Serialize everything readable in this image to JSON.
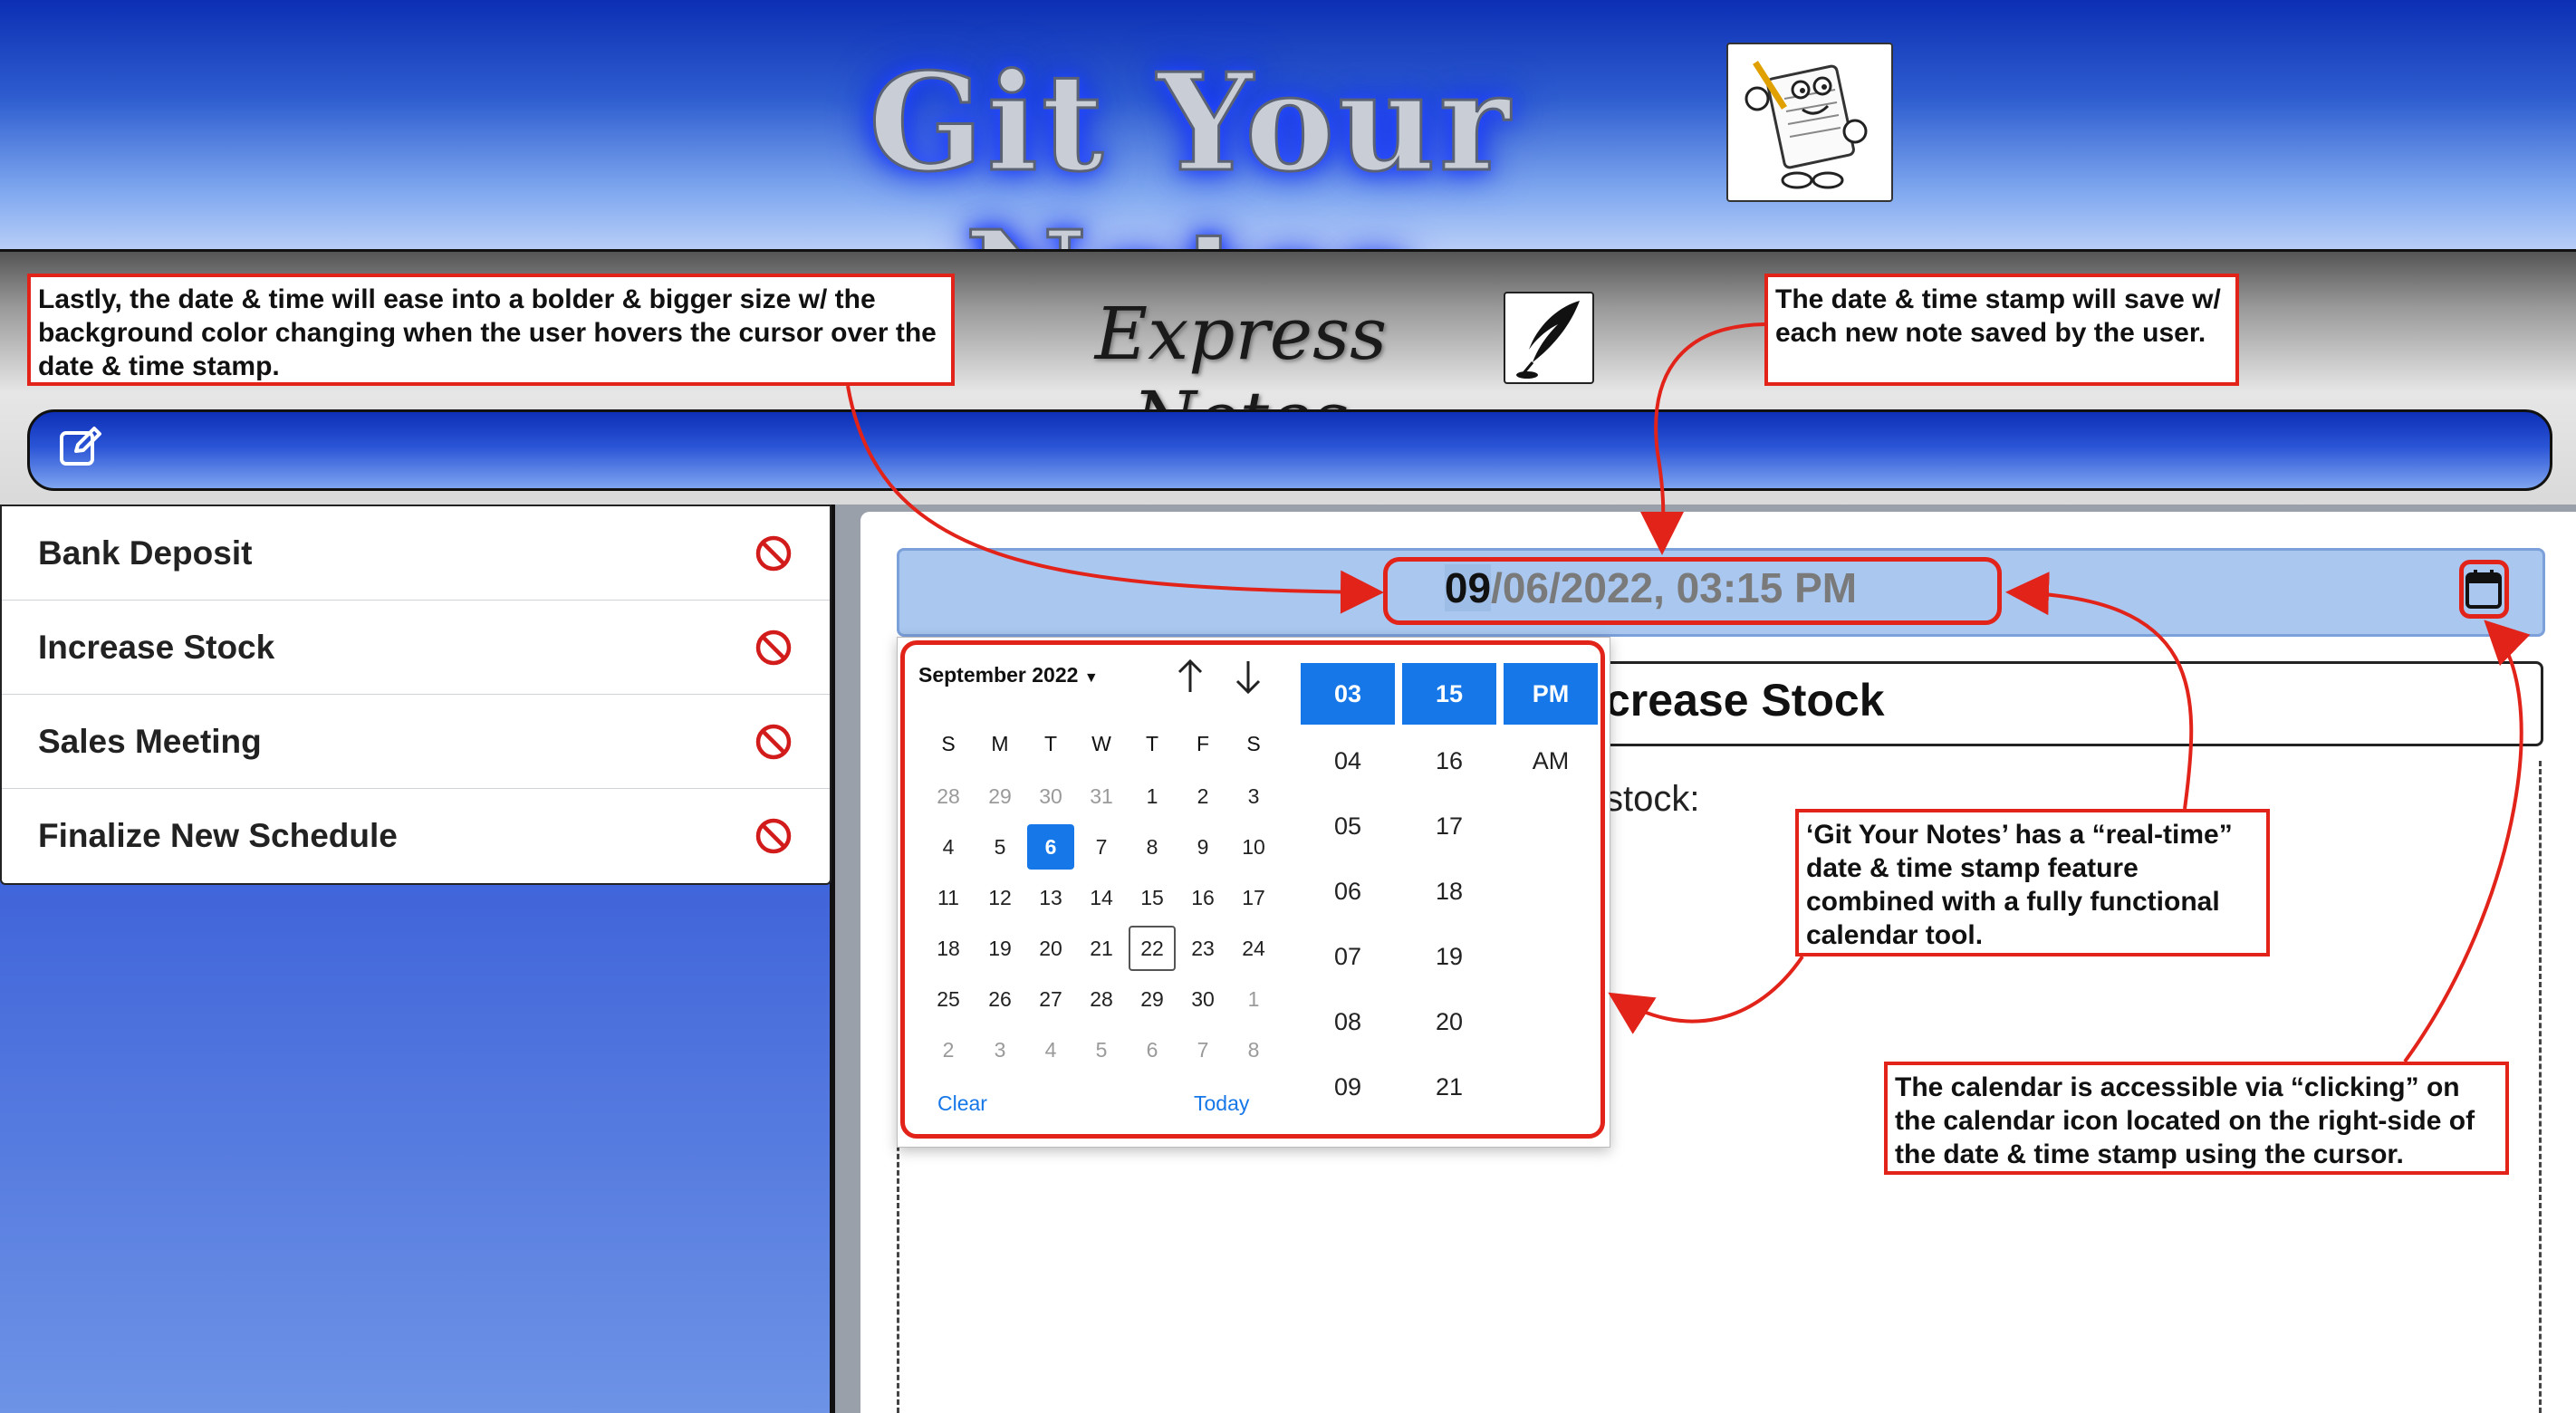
{
  "app": {
    "title": "Git Your Notes",
    "subtitle": "Express Notes",
    "logo_icon": "notepad-mascot-icon",
    "quill_icon": "quill-icon"
  },
  "toolbar": {
    "new_note_icon": "edit-icon"
  },
  "notes": [
    {
      "label": "Bank Deposit",
      "delete_icon": "no-entry-icon"
    },
    {
      "label": "Increase Stock",
      "delete_icon": "no-entry-icon"
    },
    {
      "label": "Sales Meeting",
      "delete_icon": "no-entry-icon"
    },
    {
      "label": "Finalize New Schedule",
      "delete_icon": "no-entry-icon"
    }
  ],
  "editor": {
    "datetime_highlight": "09",
    "datetime_rest": "/06/2022, 03:15 PM",
    "calendar_icon": "calendar-icon",
    "title_visible": "crease Stock",
    "body_visible": "stock:"
  },
  "picker": {
    "month": "September 2022",
    "weekdays": [
      "S",
      "M",
      "T",
      "W",
      "T",
      "F",
      "S"
    ],
    "weeks": [
      [
        "28",
        "29",
        "30",
        "31",
        "1",
        "2",
        "3"
      ],
      [
        "4",
        "5",
        "6",
        "7",
        "8",
        "9",
        "10"
      ],
      [
        "11",
        "12",
        "13",
        "14",
        "15",
        "16",
        "17"
      ],
      [
        "18",
        "19",
        "20",
        "21",
        "22",
        "23",
        "24"
      ],
      [
        "25",
        "26",
        "27",
        "28",
        "29",
        "30",
        "1"
      ],
      [
        "2",
        "3",
        "4",
        "5",
        "6",
        "7",
        "8"
      ]
    ],
    "selected_day": "6",
    "today_day": "22",
    "hours": [
      "03",
      "04",
      "05",
      "06",
      "07",
      "08",
      "09"
    ],
    "minutes": [
      "15",
      "16",
      "17",
      "18",
      "19",
      "20",
      "21"
    ],
    "ampm": [
      "PM",
      "AM"
    ],
    "clear": "Clear",
    "today": "Today"
  },
  "annotations": {
    "hover": "Lastly, the date & time will ease into a bolder & bigger size w/ the background color changing when the user hovers the cursor over the date & time stamp.",
    "save": "The date & time stamp will save w/ each new note saved by the user.",
    "realtime": "‘Git Your Notes’ has a “real-time” date & time stamp feature combined with a fully functional calendar tool.",
    "access": "The calendar is accessible via “clicking” on the calendar icon located on the right-side of the date & time stamp using the cursor."
  },
  "colors": {
    "accent": "#1677e8",
    "annotation": "#e2231a",
    "date_bar": "#a9c7ef"
  }
}
